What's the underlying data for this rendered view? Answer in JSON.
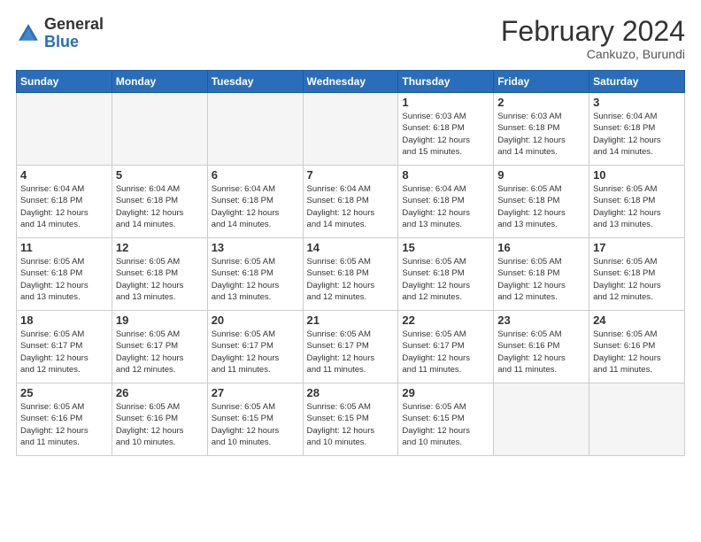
{
  "header": {
    "logo_general": "General",
    "logo_blue": "Blue",
    "month_title": "February 2024",
    "subtitle": "Cankuzo, Burundi"
  },
  "days_of_week": [
    "Sunday",
    "Monday",
    "Tuesday",
    "Wednesday",
    "Thursday",
    "Friday",
    "Saturday"
  ],
  "weeks": [
    [
      {
        "day": "",
        "info": ""
      },
      {
        "day": "",
        "info": ""
      },
      {
        "day": "",
        "info": ""
      },
      {
        "day": "",
        "info": ""
      },
      {
        "day": "1",
        "info": "Sunrise: 6:03 AM\nSunset: 6:18 PM\nDaylight: 12 hours\nand 15 minutes."
      },
      {
        "day": "2",
        "info": "Sunrise: 6:03 AM\nSunset: 6:18 PM\nDaylight: 12 hours\nand 14 minutes."
      },
      {
        "day": "3",
        "info": "Sunrise: 6:04 AM\nSunset: 6:18 PM\nDaylight: 12 hours\nand 14 minutes."
      }
    ],
    [
      {
        "day": "4",
        "info": "Sunrise: 6:04 AM\nSunset: 6:18 PM\nDaylight: 12 hours\nand 14 minutes."
      },
      {
        "day": "5",
        "info": "Sunrise: 6:04 AM\nSunset: 6:18 PM\nDaylight: 12 hours\nand 14 minutes."
      },
      {
        "day": "6",
        "info": "Sunrise: 6:04 AM\nSunset: 6:18 PM\nDaylight: 12 hours\nand 14 minutes."
      },
      {
        "day": "7",
        "info": "Sunrise: 6:04 AM\nSunset: 6:18 PM\nDaylight: 12 hours\nand 14 minutes."
      },
      {
        "day": "8",
        "info": "Sunrise: 6:04 AM\nSunset: 6:18 PM\nDaylight: 12 hours\nand 13 minutes."
      },
      {
        "day": "9",
        "info": "Sunrise: 6:05 AM\nSunset: 6:18 PM\nDaylight: 12 hours\nand 13 minutes."
      },
      {
        "day": "10",
        "info": "Sunrise: 6:05 AM\nSunset: 6:18 PM\nDaylight: 12 hours\nand 13 minutes."
      }
    ],
    [
      {
        "day": "11",
        "info": "Sunrise: 6:05 AM\nSunset: 6:18 PM\nDaylight: 12 hours\nand 13 minutes."
      },
      {
        "day": "12",
        "info": "Sunrise: 6:05 AM\nSunset: 6:18 PM\nDaylight: 12 hours\nand 13 minutes."
      },
      {
        "day": "13",
        "info": "Sunrise: 6:05 AM\nSunset: 6:18 PM\nDaylight: 12 hours\nand 13 minutes."
      },
      {
        "day": "14",
        "info": "Sunrise: 6:05 AM\nSunset: 6:18 PM\nDaylight: 12 hours\nand 12 minutes."
      },
      {
        "day": "15",
        "info": "Sunrise: 6:05 AM\nSunset: 6:18 PM\nDaylight: 12 hours\nand 12 minutes."
      },
      {
        "day": "16",
        "info": "Sunrise: 6:05 AM\nSunset: 6:18 PM\nDaylight: 12 hours\nand 12 minutes."
      },
      {
        "day": "17",
        "info": "Sunrise: 6:05 AM\nSunset: 6:18 PM\nDaylight: 12 hours\nand 12 minutes."
      }
    ],
    [
      {
        "day": "18",
        "info": "Sunrise: 6:05 AM\nSunset: 6:17 PM\nDaylight: 12 hours\nand 12 minutes."
      },
      {
        "day": "19",
        "info": "Sunrise: 6:05 AM\nSunset: 6:17 PM\nDaylight: 12 hours\nand 12 minutes."
      },
      {
        "day": "20",
        "info": "Sunrise: 6:05 AM\nSunset: 6:17 PM\nDaylight: 12 hours\nand 11 minutes."
      },
      {
        "day": "21",
        "info": "Sunrise: 6:05 AM\nSunset: 6:17 PM\nDaylight: 12 hours\nand 11 minutes."
      },
      {
        "day": "22",
        "info": "Sunrise: 6:05 AM\nSunset: 6:17 PM\nDaylight: 12 hours\nand 11 minutes."
      },
      {
        "day": "23",
        "info": "Sunrise: 6:05 AM\nSunset: 6:16 PM\nDaylight: 12 hours\nand 11 minutes."
      },
      {
        "day": "24",
        "info": "Sunrise: 6:05 AM\nSunset: 6:16 PM\nDaylight: 12 hours\nand 11 minutes."
      }
    ],
    [
      {
        "day": "25",
        "info": "Sunrise: 6:05 AM\nSunset: 6:16 PM\nDaylight: 12 hours\nand 11 minutes."
      },
      {
        "day": "26",
        "info": "Sunrise: 6:05 AM\nSunset: 6:16 PM\nDaylight: 12 hours\nand 10 minutes."
      },
      {
        "day": "27",
        "info": "Sunrise: 6:05 AM\nSunset: 6:15 PM\nDaylight: 12 hours\nand 10 minutes."
      },
      {
        "day": "28",
        "info": "Sunrise: 6:05 AM\nSunset: 6:15 PM\nDaylight: 12 hours\nand 10 minutes."
      },
      {
        "day": "29",
        "info": "Sunrise: 6:05 AM\nSunset: 6:15 PM\nDaylight: 12 hours\nand 10 minutes."
      },
      {
        "day": "",
        "info": ""
      },
      {
        "day": "",
        "info": ""
      }
    ]
  ]
}
